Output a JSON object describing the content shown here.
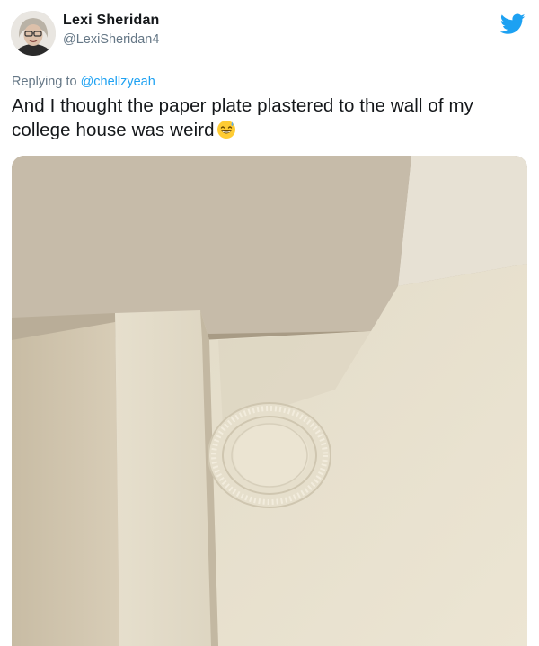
{
  "author": {
    "name": "Lexi Sheridan",
    "handle": "@LexiSheridan4"
  },
  "reply": {
    "prefix": "Replying to ",
    "mention": "@chellzyeah"
  },
  "tweet": {
    "text": "And I thought the paper plate plastered to the wall of my college house was weird",
    "emoji": "sweat-smile-emoji"
  },
  "icons": {
    "brand": "twitter-bird-icon",
    "brand_color": "#1da1f2"
  },
  "media": {
    "description_icon": "photo-of-ceiling-corner-with-paper-plate"
  }
}
